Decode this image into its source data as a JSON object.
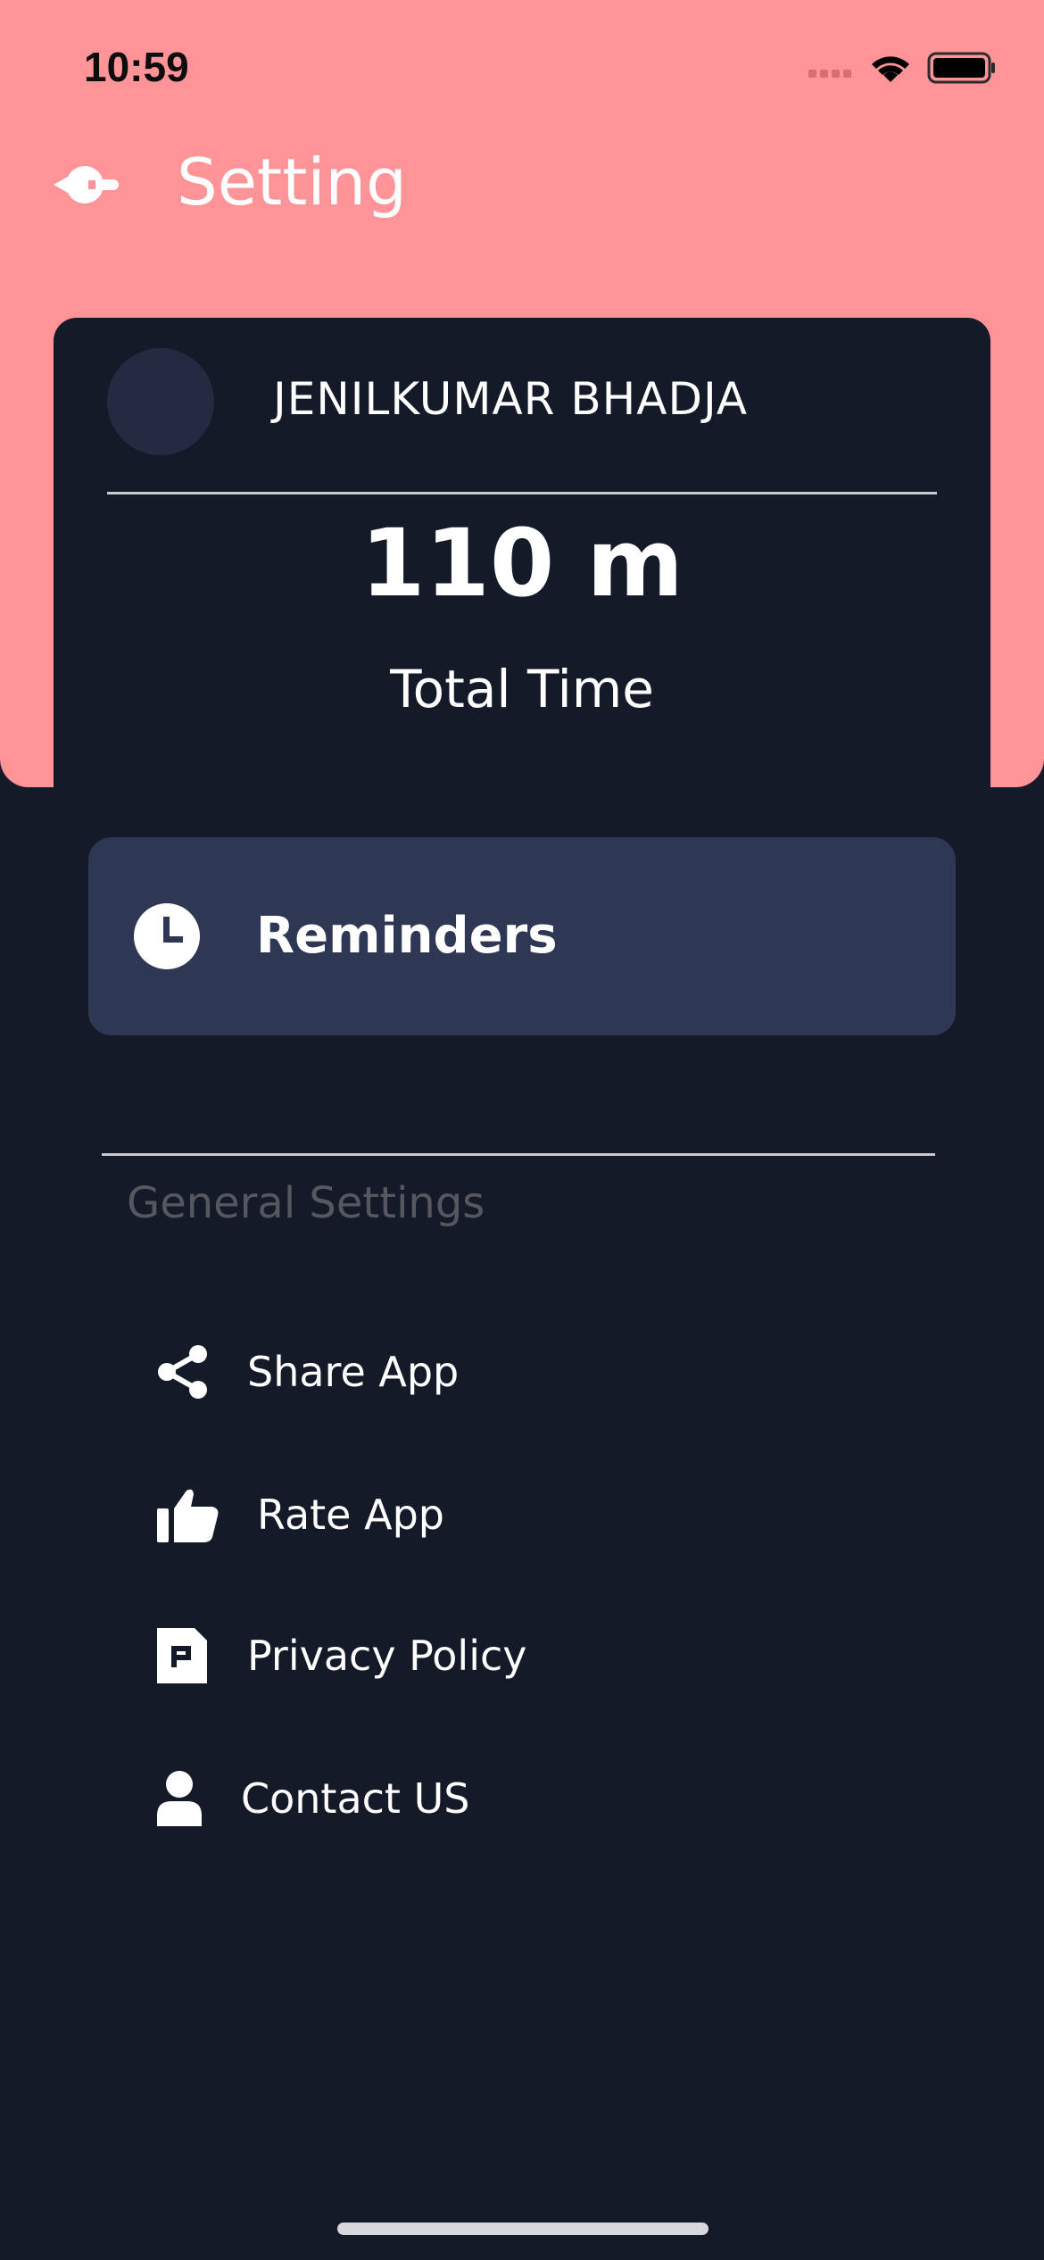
{
  "status_bar": {
    "time": "10:59"
  },
  "header": {
    "title": "Setting"
  },
  "profile": {
    "name": "JENILKUMAR BHADJA",
    "total_value": "110 m",
    "total_label": "Total Time"
  },
  "reminders": {
    "label": "Reminders"
  },
  "general": {
    "section_title": "General Settings",
    "items": [
      {
        "label": "Share App",
        "icon": "share-icon"
      },
      {
        "label": "Rate App",
        "icon": "thumbs-up-icon"
      },
      {
        "label": "Privacy Policy",
        "icon": "document-icon"
      },
      {
        "label": "Contact US",
        "icon": "person-icon"
      }
    ]
  },
  "colors": {
    "header_bg": "#fe9398",
    "page_bg": "#151a29",
    "reminder_card": "#2e3753",
    "muted_text": "#55585f"
  }
}
